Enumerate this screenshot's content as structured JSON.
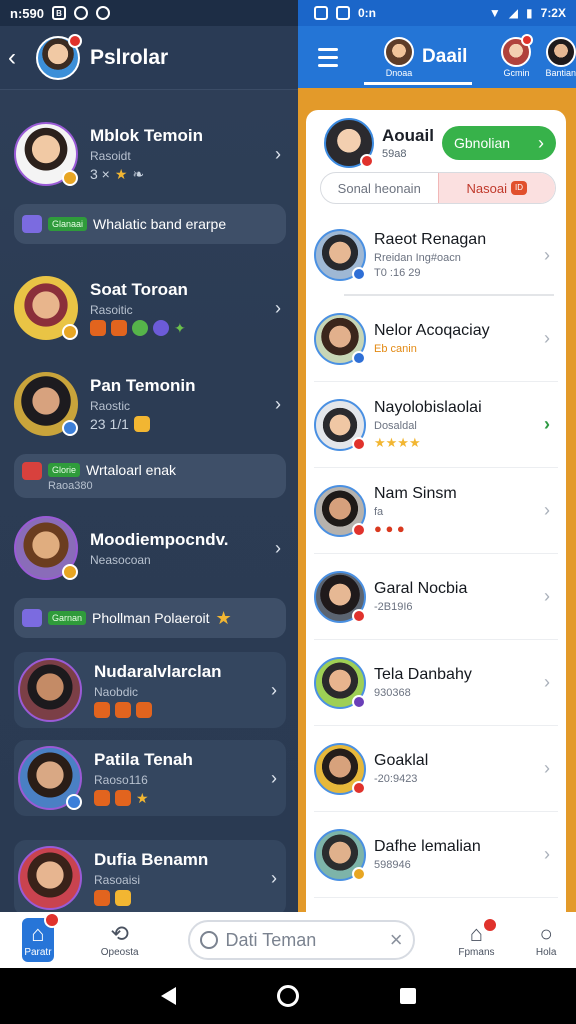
{
  "status_bar": {
    "left_time": "n:590",
    "left_icons": [
      "B",
      "0",
      "0"
    ],
    "right_label": "0:n",
    "right_battery": "7:2X"
  },
  "left_panel": {
    "title": "Pslrolar",
    "items": [
      {
        "name": "Mblok Temoin",
        "sub": "Rasoidt",
        "extra": "3 ×"
      },
      {
        "status_tag": "Glanaai",
        "status_text": "Whalatic band erarpe"
      },
      {
        "name": "Soat Toroan",
        "sub": "Rasoitic"
      },
      {
        "name": "Pan Temonin",
        "sub": "Raostic",
        "extra": "23 1/1"
      },
      {
        "status_tag": "Glorie",
        "status_text": "Wrtaloarl enak",
        "status_sub": "Raoa380"
      },
      {
        "name": "Moodiempocndv.",
        "sub": "Neasocoan"
      },
      {
        "status_tag": "Garnan",
        "status_text": "Phollman Polaeroit"
      },
      {
        "name": "Nudaralvlarclan",
        "sub": "Naobdic"
      },
      {
        "name": "Patila Tenah",
        "sub": "Raoso116"
      },
      {
        "name": "Dufia Benamn",
        "sub": "Rasoaisi"
      }
    ]
  },
  "right_panel": {
    "tabs": [
      {
        "label": "Daail",
        "small": "Dnoaa"
      },
      {
        "label": "",
        "small": "Gcmin"
      },
      {
        "label": "",
        "small": "Bantian"
      }
    ],
    "sheet": {
      "name": "Aouail",
      "sub": "59a8",
      "button": "Gbnolian",
      "segment_a": "Sonal heonain",
      "segment_b": "Nasoai",
      "segment_b_badge": "ID"
    },
    "rows": [
      {
        "name": "Raeot Renagan",
        "sub": "Rreidan Ing#oacn",
        "sub2": "T0 :16 29"
      },
      {
        "name": "Nelor Acoqaciay",
        "sub": "Eb canin"
      },
      {
        "name": "Nayolobislaolai",
        "sub": "Dosaldal"
      },
      {
        "name": "Nam Sinsm",
        "sub": "fa"
      },
      {
        "name": "Garal Nocbia",
        "sub": "-2B19I6"
      },
      {
        "name": "Tela Danbahy",
        "sub": "930368"
      },
      {
        "name": "Goaklal",
        "sub": "-20:9423"
      },
      {
        "name": "Dafhe lemalian",
        "sub": "598946"
      }
    ]
  },
  "bottom_nav": {
    "items": [
      {
        "label": "Paratr"
      },
      {
        "label": "Opeosta"
      },
      {
        "label": "Fpmans"
      },
      {
        "label": "Hola"
      }
    ],
    "search_placeholder": "Dati Teman"
  },
  "colors": {
    "left_bg": "#2e3f58",
    "right_header": "#2475d6",
    "accent_green": "#37b24a",
    "badge_red": "#e0322c"
  }
}
